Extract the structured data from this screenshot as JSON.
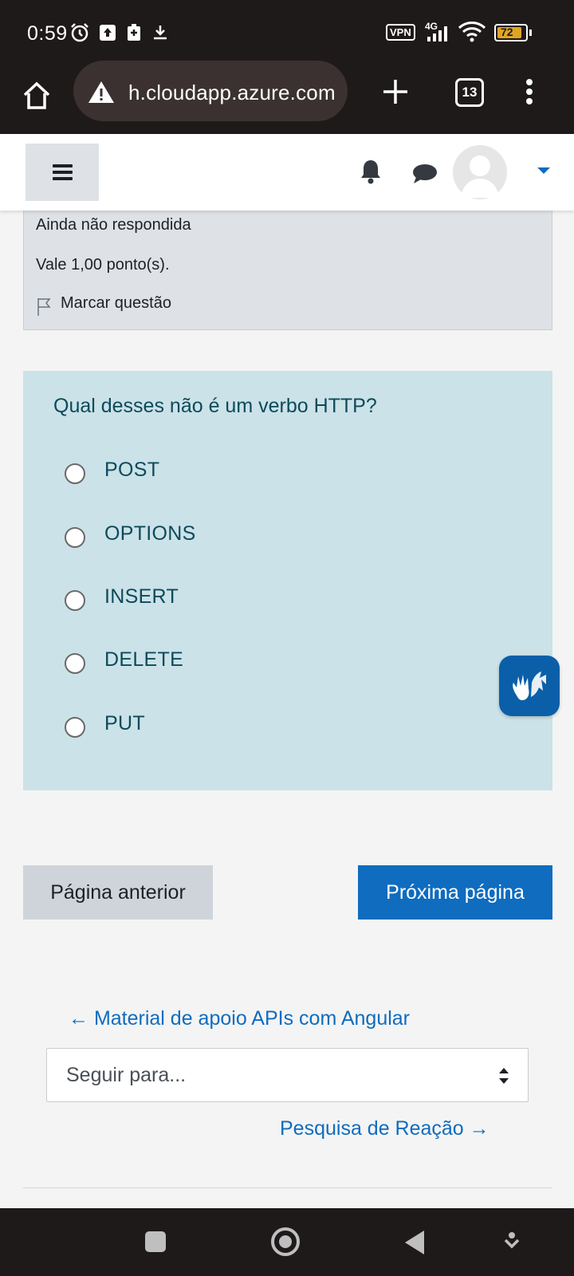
{
  "status_bar": {
    "time": "0:59",
    "vpn_label": "VPN",
    "network_label": "4G",
    "battery": "72"
  },
  "browser": {
    "url": "h.cloudapp.azure.com",
    "tab_count": "13",
    "icons": [
      "home-icon",
      "warning-icon",
      "plus-icon",
      "more-vert-icon"
    ]
  },
  "navbar": {
    "icons": [
      "hamburger-icon",
      "bell-icon",
      "chat-icon",
      "avatar",
      "caret-down-icon"
    ]
  },
  "question_info": {
    "state": "Ainda não respondida",
    "grade": "Vale 1,00 ponto(s).",
    "flag_label": "Marcar questão"
  },
  "question": {
    "text": "Qual desses não é um verbo HTTP?",
    "options": [
      "POST",
      "OPTIONS",
      "INSERT",
      "DELETE",
      "PUT"
    ]
  },
  "buttons": {
    "prev": "Página anterior",
    "next": "Próxima página"
  },
  "activity_nav": {
    "prev_link": "← Material de apoio APIs com Angular",
    "jump_placeholder": "Seguir para...",
    "next_link": "Pesquisa de Reação →"
  },
  "colors": {
    "primary": "#0f6cbf",
    "question_bg": "#cbe2e8",
    "info_bg": "#dee2e6"
  }
}
